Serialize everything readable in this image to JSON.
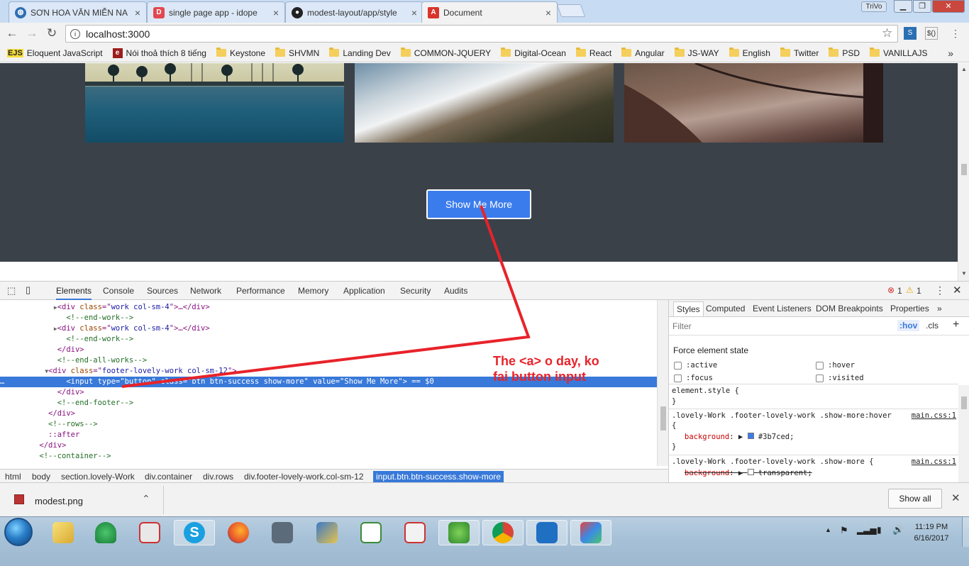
{
  "browser": {
    "tabs": [
      {
        "title": "SƠN HOA VĂN MIỄN NA",
        "icon": "globe-icon"
      },
      {
        "title": "single page app - idope",
        "icon": "idope-icon"
      },
      {
        "title": "modest-layout/app/style",
        "icon": "github-icon"
      },
      {
        "title": "Document",
        "icon": "angular-icon"
      }
    ],
    "user": "TriVo",
    "url": "localhost:3000",
    "bookmarks": [
      {
        "label": "Eloquent JavaScript",
        "icon": "ejs-icon"
      },
      {
        "label": "Nói thoả thích 8 tiếng",
        "icon": "e-icon"
      },
      {
        "label": "Keystone",
        "icon": "folder-icon"
      },
      {
        "label": "SHVMN",
        "icon": "folder-icon"
      },
      {
        "label": "Landing Dev",
        "icon": "folder-icon"
      },
      {
        "label": "COMMON-JQUERY",
        "icon": "folder-icon"
      },
      {
        "label": "Digital-Ocean",
        "icon": "folder-icon"
      },
      {
        "label": "React",
        "icon": "folder-icon"
      },
      {
        "label": "Angular",
        "icon": "folder-icon"
      },
      {
        "label": "JS-WAY",
        "icon": "folder-icon"
      },
      {
        "label": "English",
        "icon": "folder-icon"
      },
      {
        "label": "Twitter",
        "icon": "folder-icon"
      },
      {
        "label": "PSD",
        "icon": "folder-icon"
      },
      {
        "label": "VANILLAJS",
        "icon": "folder-icon"
      }
    ]
  },
  "page": {
    "show_more_label": "Show Me More"
  },
  "devtools": {
    "tabs": [
      "Elements",
      "Console",
      "Sources",
      "Network",
      "Performance",
      "Memory",
      "Application",
      "Security",
      "Audits"
    ],
    "errors": "1",
    "warnings": "1",
    "dom_lines": [
      {
        "indent": 6,
        "arrow": "▶",
        "parts": [
          [
            "tg",
            "<div "
          ],
          [
            "at",
            "class"
          ],
          [
            "tg",
            "=\""
          ],
          [
            "av",
            "work col-sm-4"
          ],
          [
            "tg",
            "\">…</div>"
          ]
        ]
      },
      {
        "indent": 7,
        "arrow": "",
        "parts": [
          [
            "cm",
            "<!--end-work-->"
          ]
        ]
      },
      {
        "indent": 6,
        "arrow": "▶",
        "parts": [
          [
            "tg",
            "<div "
          ],
          [
            "at",
            "class"
          ],
          [
            "tg",
            "=\""
          ],
          [
            "av",
            "work col-sm-4"
          ],
          [
            "tg",
            "\">…</div>"
          ]
        ]
      },
      {
        "indent": 7,
        "arrow": "",
        "parts": [
          [
            "cm",
            "<!--end-work-->"
          ]
        ]
      },
      {
        "indent": 6,
        "arrow": "",
        "parts": [
          [
            "tg",
            "</div>"
          ]
        ]
      },
      {
        "indent": 6,
        "arrow": "",
        "parts": [
          [
            "cm",
            "<!--end-all-works-->"
          ]
        ]
      },
      {
        "indent": 5,
        "arrow": "▼",
        "parts": [
          [
            "tg",
            "<div "
          ],
          [
            "at",
            "class"
          ],
          [
            "tg",
            "=\""
          ],
          [
            "av",
            "footer-lovely-work col-sm-12"
          ],
          [
            "tg",
            "\">"
          ]
        ]
      },
      {
        "indent": 7,
        "arrow": "",
        "selected": true,
        "parts": [
          [
            "tg",
            "<input "
          ],
          [
            "at",
            "type"
          ],
          [
            "tg",
            "=\""
          ],
          [
            "av",
            "button"
          ],
          [
            "tg",
            "\" "
          ],
          [
            "at",
            "class"
          ],
          [
            "tg",
            "=\""
          ],
          [
            "av",
            "btn btn-success show-more"
          ],
          [
            "tg",
            "\" "
          ],
          [
            "at",
            "value"
          ],
          [
            "tg",
            "=\""
          ],
          [
            "av",
            "Show Me More"
          ],
          [
            "tg",
            "\"> == $0"
          ]
        ]
      },
      {
        "indent": 6,
        "arrow": "",
        "parts": [
          [
            "tg",
            "</div>"
          ]
        ]
      },
      {
        "indent": 6,
        "arrow": "",
        "parts": [
          [
            "cm",
            "<!--end-footer-->"
          ]
        ]
      },
      {
        "indent": 5,
        "arrow": "",
        "parts": [
          [
            "tg",
            "</div>"
          ]
        ]
      },
      {
        "indent": 5,
        "arrow": "",
        "parts": [
          [
            "cm",
            "<!--rows-->"
          ]
        ]
      },
      {
        "indent": 5,
        "arrow": "",
        "parts": [
          [
            "tg",
            "::after"
          ]
        ]
      },
      {
        "indent": 4,
        "arrow": "",
        "parts": [
          [
            "tg",
            "</div>"
          ]
        ]
      },
      {
        "indent": 4,
        "arrow": "",
        "parts": [
          [
            "cm",
            "<!--container-->"
          ]
        ]
      }
    ],
    "breadcrumb": [
      "html",
      "body",
      "section.lovely-Work",
      "div.container",
      "div.rows",
      "div.footer-lovely-work.col-sm-12",
      "input.btn.btn-success.show-more"
    ],
    "styles_tabs": [
      "Styles",
      "Computed",
      "Event Listeners",
      "DOM Breakpoints",
      "Properties"
    ],
    "filter_placeholder": "Filter",
    "hov": ":hov",
    "cls": ".cls",
    "force_state_title": "Force element state",
    "states": [
      ":active",
      ":hover",
      ":focus",
      ":visited"
    ],
    "element_style": "element.style {",
    "rule1_selector": ".lovely-Work .footer-lovely-work .show-more:hover",
    "rule1_source": "main.css:1",
    "rule1_prop": "background",
    "rule1_value": "#3b7ced;",
    "rule2_selector": ".lovely-Work .footer-lovely-work .show-more {",
    "rule2_source": "main.css:1",
    "rule2_prop": "background",
    "rule2_value": "transparent;"
  },
  "downloads": {
    "file": "modest.png",
    "show_all": "Show all"
  },
  "taskbar": {
    "time": "11:19 PM",
    "date": "6/16/2017"
  },
  "annotation": {
    "text": "The <a> o day, ko\nfai button input",
    "color": "#e8232a"
  },
  "colors": {
    "button": "#3b7ced",
    "page_bg": "#3a4149",
    "selection": "#3879d9"
  }
}
